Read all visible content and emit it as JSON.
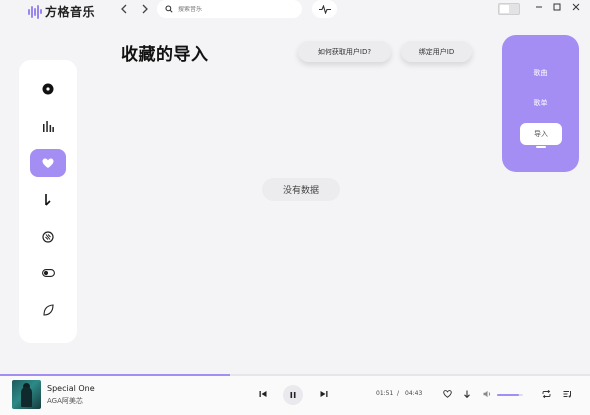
{
  "app": {
    "title": "方格音乐"
  },
  "search": {
    "placeholder": "搜索音乐"
  },
  "page": {
    "title": "收藏的导入",
    "how_to_get_id": "如何获取用户ID?",
    "bind_user_id": "绑定用户ID",
    "empty_text": "没有数据"
  },
  "right_panel": {
    "songs": "歌曲",
    "playlists": "歌单",
    "import": "导入"
  },
  "player": {
    "song_title": "Special One",
    "artist": "AGA阿美芯",
    "current_time": "01:51",
    "separator": "/",
    "total_time": "04:43",
    "progress": 0.39,
    "volume": 0.85
  },
  "colors": {
    "accent": "#a48ef3",
    "background": "#f4f4f6"
  },
  "sidebar": {
    "items": [
      {
        "icon": "disc-icon"
      },
      {
        "icon": "bar-chart-icon"
      },
      {
        "icon": "heart-icon",
        "active": true
      },
      {
        "icon": "download-arrow-icon"
      },
      {
        "icon": "sliders-icon"
      },
      {
        "icon": "toggle-icon"
      },
      {
        "icon": "leaf-icon"
      }
    ]
  }
}
